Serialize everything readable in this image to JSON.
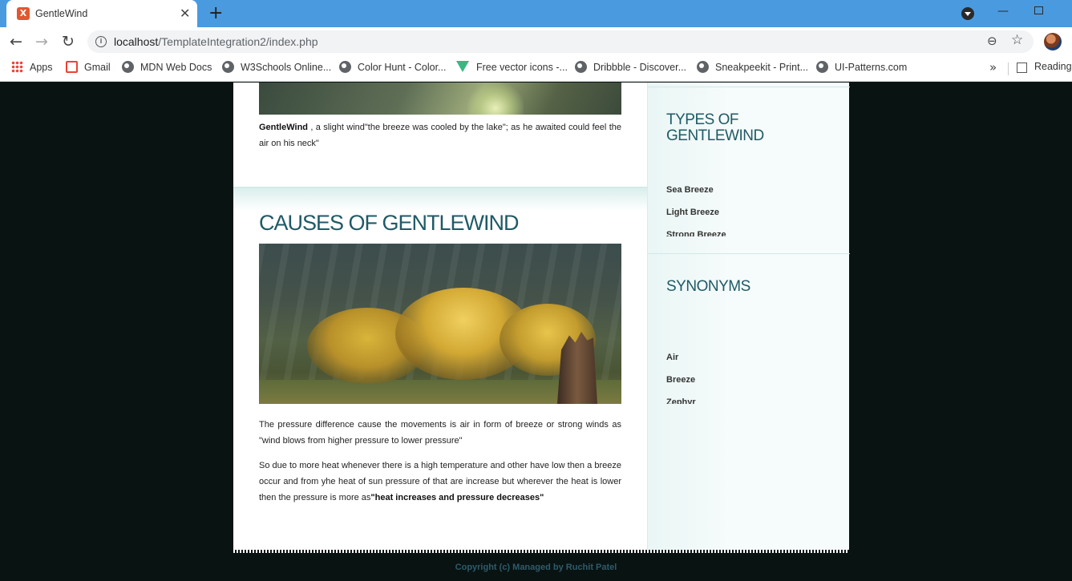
{
  "browser": {
    "tab_title": "GentleWind",
    "tab_favicon_glyph": "X",
    "url_host": "localhost",
    "url_path": "/TemplateIntegration2/index.php",
    "bookmarks": [
      {
        "label": "Apps",
        "icon": "apps-icon"
      },
      {
        "label": "Gmail",
        "icon": "gmail-icon"
      },
      {
        "label": "MDN Web Docs",
        "icon": "globe-icon"
      },
      {
        "label": "W3Schools Online...",
        "icon": "globe-icon"
      },
      {
        "label": "Color Hunt - Color...",
        "icon": "globe-icon"
      },
      {
        "label": "Free vector icons -...",
        "icon": "vector-icon"
      },
      {
        "label": "Dribbble - Discover...",
        "icon": "globe-icon"
      },
      {
        "label": "Sneakpeekit - Print...",
        "icon": "globe-icon"
      },
      {
        "label": "UI-Patterns.com",
        "icon": "globe-icon"
      }
    ],
    "reading_list": "Reading"
  },
  "main": {
    "intro": {
      "bold": "GentleWind",
      "text": " , a slight wind\"the breeze was cooled by the lake\"; as he awaited could feel the air on his neck\""
    },
    "causes": {
      "heading": "CAUSES OF GENTLEWIND",
      "p1": "The pressure difference cause the movements is air in form of breeze or strong winds as \"wind blows from higher pressure to lower pressure\"",
      "p2_text": "So due to more heat whenever there is a high temperature and other have low then a breeze occur and from yhe heat of sun pressure of that are increase but wherever the heat is lower then the pressure is more as",
      "p2_bold": "\"heat increases and pressure decreases\""
    }
  },
  "sidebar": {
    "types": {
      "heading": "TYPES OF GENTLEWIND",
      "items": [
        "Sea Breeze",
        "Light Breeze",
        "Strong Breeze"
      ]
    },
    "synonyms": {
      "heading": "SYNONYMS",
      "items": [
        "Air",
        "Breeze",
        "Zephyr"
      ]
    }
  },
  "footer": {
    "text": "Copyright (c) Managed by Ruchit Patel"
  },
  "colors": {
    "accent_heading": "#1f5a66",
    "page_background": "#091312",
    "titlebar": "#4a9ae0"
  }
}
